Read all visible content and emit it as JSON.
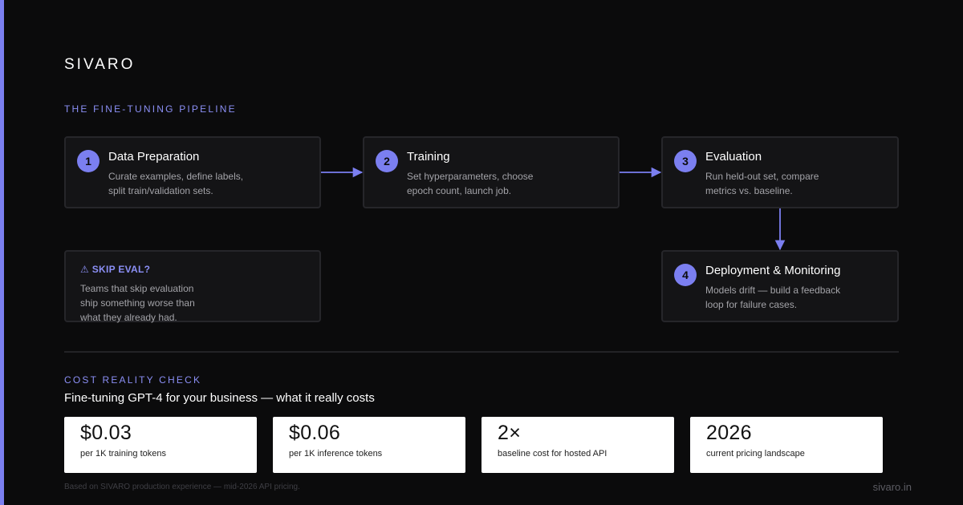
{
  "brand": "SIVARO",
  "pipeline": {
    "label": "THE FINE-TUNING PIPELINE",
    "steps": [
      {
        "num": "1",
        "title": "Data Preparation",
        "desc": [
          "Curate examples, define labels,",
          "split train/validation sets."
        ]
      },
      {
        "num": "2",
        "title": "Training",
        "desc": [
          "Set hyperparameters, choose",
          "epoch count, launch job."
        ]
      },
      {
        "num": "3",
        "title": "Evaluation",
        "desc": [
          "Run held-out set, compare",
          "metrics vs. baseline."
        ]
      },
      {
        "num": "4",
        "title": "Deployment & Monitoring",
        "desc": [
          "Models drift — build a feedback",
          "loop for failure cases."
        ]
      }
    ],
    "warning": {
      "title": "⚠ SKIP EVAL?",
      "desc": [
        "Teams that skip evaluation",
        "ship something worse than",
        "what they already had."
      ]
    }
  },
  "costs": {
    "label": "COST REALITY CHECK",
    "headline": "Fine-tuning GPT-4 for your business — what it really costs",
    "stats": [
      {
        "value": "$0.03",
        "label": "per 1K training tokens"
      },
      {
        "value": "$0.06",
        "label": "per 1K inference tokens"
      },
      {
        "value": "2×",
        "label": "baseline cost for hosted API"
      },
      {
        "value": "2026",
        "label": "current pricing landscape"
      }
    ]
  },
  "footer": {
    "note": "Based on SIVARO production experience — mid-2026 API pricing.",
    "site": "sivaro.in"
  },
  "colors": {
    "accent": "#7b7ff0",
    "background": "#0b0b0c",
    "card": "#141416"
  }
}
